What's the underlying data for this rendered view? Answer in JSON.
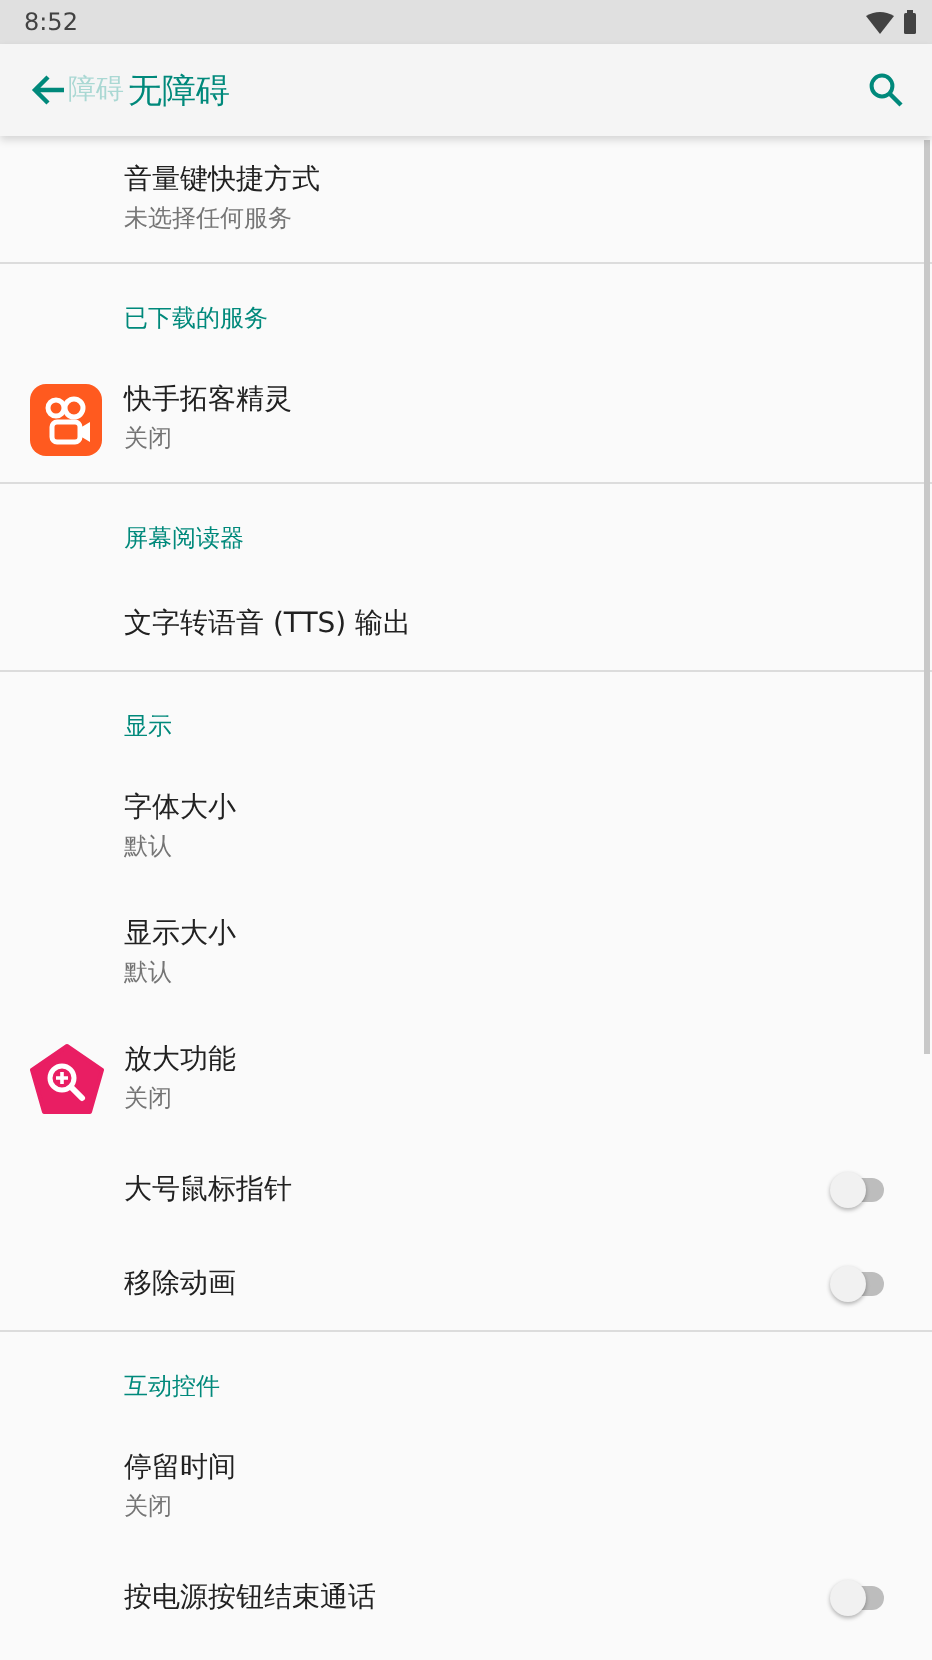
{
  "status_bar": {
    "time": "8:52"
  },
  "toolbar": {
    "ghost_title": "障碍",
    "title": "无障碍"
  },
  "sections": [
    {
      "rows": [
        {
          "kind": "plain",
          "title": "音量键快捷方式",
          "subtitle": "未选择任何服务"
        }
      ]
    },
    {
      "header": "已下载的服务",
      "rows": [
        {
          "kind": "camera-app",
          "title": "快手拓客精灵",
          "subtitle": "关闭"
        }
      ]
    },
    {
      "header": "屏幕阅读器",
      "rows": [
        {
          "kind": "plain",
          "title": "文字转语音 (TTS) 输出"
        }
      ]
    },
    {
      "header": "显示",
      "rows": [
        {
          "kind": "plain",
          "title": "字体大小",
          "subtitle": "默认"
        },
        {
          "kind": "plain",
          "title": "显示大小",
          "subtitle": "默认"
        },
        {
          "kind": "magnifier-app",
          "title": "放大功能",
          "subtitle": "关闭"
        },
        {
          "kind": "switch",
          "title": "大号鼠标指针",
          "on": false
        },
        {
          "kind": "switch",
          "title": "移除动画",
          "on": false
        }
      ]
    },
    {
      "header": "互动控件",
      "rows": [
        {
          "kind": "plain",
          "title": "停留时间",
          "subtitle": "关闭"
        },
        {
          "kind": "switch",
          "title": "按电源按钮结束通话",
          "on": false
        }
      ]
    }
  ]
}
